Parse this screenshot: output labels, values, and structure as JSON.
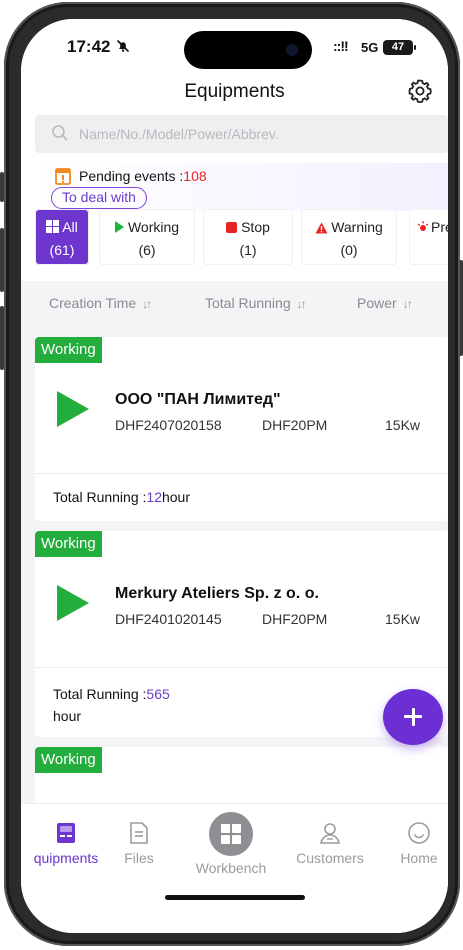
{
  "status_bar": {
    "time": "17:42",
    "signal": "::!!",
    "network": "5G",
    "battery": "47"
  },
  "header": {
    "title": "Equipments"
  },
  "search": {
    "placeholder": "Name/No./Model/Power/Abbrev."
  },
  "pending": {
    "label": "Pending events :",
    "count": "108",
    "action": "To deal with"
  },
  "filters": [
    {
      "label": "All",
      "count": "(61)"
    },
    {
      "label": "Working",
      "count": "(6)"
    },
    {
      "label": "Stop",
      "count": "(1)"
    },
    {
      "label": "Warning",
      "count": "(0)"
    },
    {
      "label": "Pre",
      "count": ""
    }
  ],
  "sort": [
    {
      "label": "Creation Time",
      "arrow": "↓↑"
    },
    {
      "label": "Total Running",
      "arrow": "↓↑"
    },
    {
      "label": "Power",
      "arrow": "↓↑"
    }
  ],
  "cards": [
    {
      "status": "Working",
      "name": "ООО \"ПАН Лимитед\"",
      "serial": "DHF2407020158",
      "model": "DHF20PM",
      "power": "15Kw",
      "running_label": "Total Running :",
      "running_value": "12",
      "running_unit": "hour"
    },
    {
      "status": "Working",
      "name": "Merkury Ateliers Sp. z o. o.",
      "serial": "DHF2401020145",
      "model": "DHF20PM",
      "power": "15Kw",
      "running_label": "Total Running :",
      "running_value": "565",
      "running_unit": "hour"
    },
    {
      "status": "Working"
    }
  ],
  "tabs": [
    {
      "label": "quipments"
    },
    {
      "label": "Files"
    },
    {
      "label": "Workbench"
    },
    {
      "label": "Customers"
    },
    {
      "label": "Home"
    }
  ],
  "colors": {
    "accent": "#6c36cf",
    "working": "#22ad3c",
    "alert": "#e52525"
  }
}
